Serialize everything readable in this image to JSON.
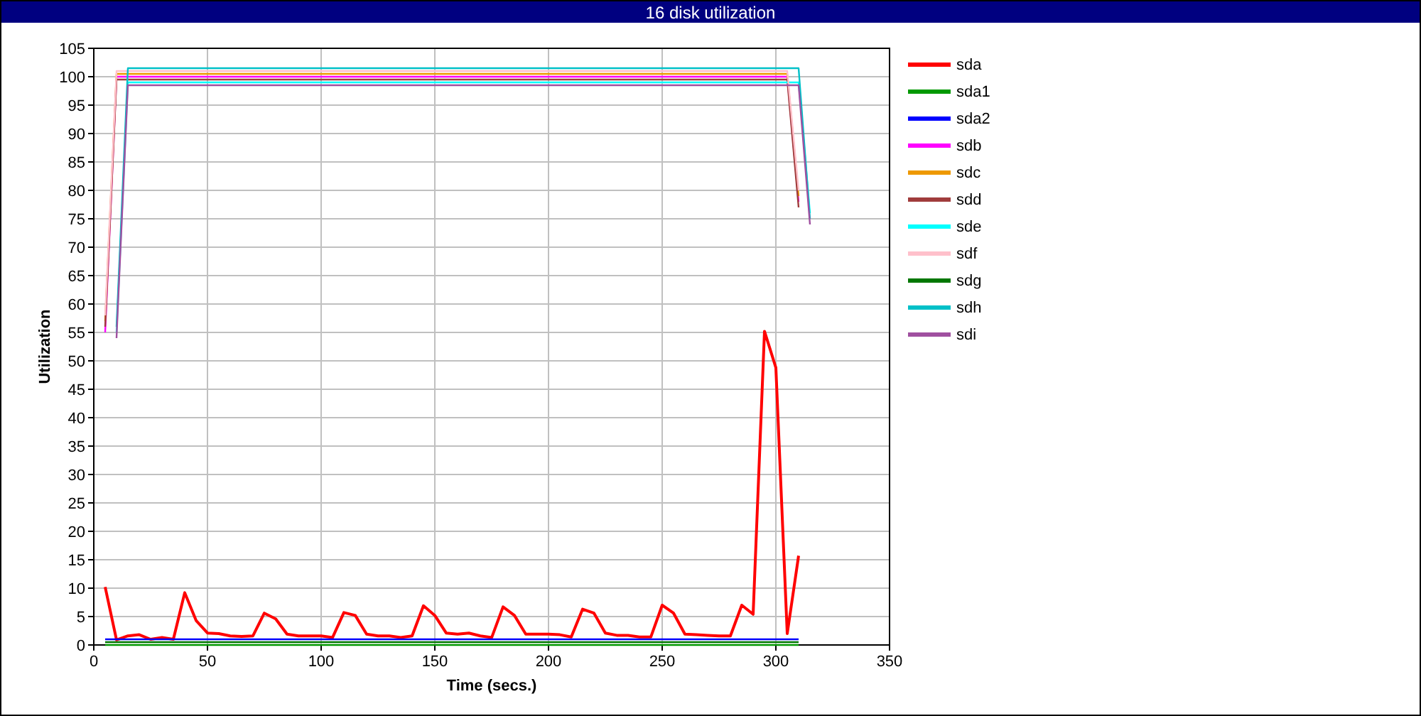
{
  "window": {
    "title": "16 disk utilization"
  },
  "chart": {
    "chart_data": {
      "type": "line",
      "grid": true,
      "xlabel": "Time (secs.)",
      "ylabel": "Utilization",
      "xlim": [
        0,
        350
      ],
      "ylim": [
        0,
        105
      ],
      "xticks": [
        0,
        50,
        100,
        150,
        200,
        250,
        300,
        350
      ],
      "yticks": [
        0,
        5,
        10,
        15,
        20,
        25,
        30,
        35,
        40,
        45,
        50,
        55,
        60,
        65,
        70,
        75,
        80,
        85,
        90,
        95,
        100,
        105
      ],
      "x": [
        5,
        10,
        15,
        20,
        25,
        30,
        35,
        40,
        45,
        50,
        55,
        60,
        65,
        70,
        75,
        80,
        85,
        90,
        95,
        100,
        105,
        110,
        115,
        120,
        125,
        130,
        135,
        140,
        145,
        150,
        155,
        160,
        165,
        170,
        175,
        180,
        185,
        190,
        195,
        200,
        205,
        210,
        215,
        220,
        225,
        230,
        235,
        240,
        245,
        250,
        255,
        260,
        265,
        270,
        275,
        280,
        285,
        290,
        295,
        300,
        305,
        310,
        315
      ],
      "series": [
        {
          "name": "sda",
          "color": "#ff0000",
          "values": [
            10.2,
            0.9,
            1.6,
            1.8,
            1.0,
            1.3,
            1.0,
            9.2,
            4.3,
            2.1,
            2.0,
            1.6,
            1.5,
            1.6,
            5.6,
            4.6,
            1.9,
            1.6,
            1.6,
            1.6,
            1.3,
            5.7,
            5.2,
            1.9,
            1.6,
            1.6,
            1.3,
            1.6,
            6.9,
            5.2,
            2.1,
            1.9,
            2.1,
            1.6,
            1.3,
            6.7,
            5.2,
            1.9,
            1.9,
            1.9,
            1.8,
            1.4,
            6.3,
            5.6,
            2.1,
            1.7,
            1.7,
            1.4,
            1.4,
            7.0,
            5.6,
            1.9,
            1.8,
            1.7,
            1.6,
            1.6,
            7.0,
            5.4,
            55.2,
            48.8,
            2.0,
            15.7,
            null
          ]
        },
        {
          "name": "sda1",
          "color": "#009900",
          "values": [
            0,
            0,
            0,
            0,
            0,
            0,
            0,
            0,
            0,
            0,
            0,
            0,
            0,
            0,
            0,
            0,
            0,
            0,
            0,
            0,
            0,
            0,
            0,
            0,
            0,
            0,
            0,
            0,
            0,
            0,
            0,
            0,
            0,
            0,
            0,
            0,
            0,
            0,
            0,
            0,
            0,
            0,
            0,
            0,
            0,
            0,
            0,
            0,
            0,
            0,
            0,
            0,
            0,
            0,
            0,
            0,
            0,
            0,
            0,
            0,
            0,
            0,
            null
          ]
        },
        {
          "name": "sda2",
          "color": "#0000ff",
          "values": [
            1,
            1,
            1,
            1,
            1,
            1,
            1,
            1,
            1,
            1,
            1,
            1,
            1,
            1,
            1,
            1,
            1,
            1,
            1,
            1,
            1,
            1,
            1,
            1,
            1,
            1,
            1,
            1,
            1,
            1,
            1,
            1,
            1,
            1,
            1,
            1,
            1,
            1,
            1,
            1,
            1,
            1,
            1,
            1,
            1,
            1,
            1,
            1,
            1,
            1,
            1,
            1,
            1,
            1,
            1,
            1,
            1,
            1,
            1,
            1,
            1,
            1,
            null
          ]
        },
        {
          "name": "sdb",
          "color": "#ff00ff",
          "values": [
            55,
            100,
            100,
            100,
            100,
            100,
            100,
            100,
            100,
            100,
            100,
            100,
            100,
            100,
            100,
            100,
            100,
            100,
            100,
            100,
            100,
            100,
            100,
            100,
            100,
            100,
            100,
            100,
            100,
            100,
            100,
            100,
            100,
            100,
            100,
            100,
            100,
            100,
            100,
            100,
            100,
            100,
            100,
            100,
            100,
            100,
            100,
            100,
            100,
            100,
            100,
            100,
            100,
            100,
            100,
            100,
            100,
            100,
            100,
            100,
            100,
            78,
            null
          ]
        },
        {
          "name": "sdc",
          "color": "#ee9900",
          "values": [
            57,
            100.5,
            100.5,
            100.5,
            100.5,
            100.5,
            100.5,
            100.5,
            100.5,
            100.5,
            100.5,
            100.5,
            100.5,
            100.5,
            100.5,
            100.5,
            100.5,
            100.5,
            100.5,
            100.5,
            100.5,
            100.5,
            100.5,
            100.5,
            100.5,
            100.5,
            100.5,
            100.5,
            100.5,
            100.5,
            100.5,
            100.5,
            100.5,
            100.5,
            100.5,
            100.5,
            100.5,
            100.5,
            100.5,
            100.5,
            100.5,
            100.5,
            100.5,
            100.5,
            100.5,
            100.5,
            100.5,
            100.5,
            100.5,
            100.5,
            100.5,
            100.5,
            100.5,
            100.5,
            100.5,
            100.5,
            100.5,
            100.5,
            100.5,
            100.5,
            100.5,
            79,
            null
          ]
        },
        {
          "name": "sdd",
          "color": "#a03c3c",
          "values": [
            56,
            99.5,
            99.5,
            99.5,
            99.5,
            99.5,
            99.5,
            99.5,
            99.5,
            99.5,
            99.5,
            99.5,
            99.5,
            99.5,
            99.5,
            99.5,
            99.5,
            99.5,
            99.5,
            99.5,
            99.5,
            99.5,
            99.5,
            99.5,
            99.5,
            99.5,
            99.5,
            99.5,
            99.5,
            99.5,
            99.5,
            99.5,
            99.5,
            99.5,
            99.5,
            99.5,
            99.5,
            99.5,
            99.5,
            99.5,
            99.5,
            99.5,
            99.5,
            99.5,
            99.5,
            99.5,
            99.5,
            99.5,
            99.5,
            99.5,
            99.5,
            99.5,
            99.5,
            99.5,
            99.5,
            99.5,
            99.5,
            99.5,
            99.5,
            99.5,
            99.5,
            77,
            null
          ]
        },
        {
          "name": "sde",
          "color": "#00ffff",
          "values": [
            null,
            55,
            99,
            99,
            99,
            99,
            99,
            99,
            99,
            99,
            99,
            99,
            99,
            99,
            99,
            99,
            99,
            99,
            99,
            99,
            99,
            99,
            99,
            99,
            99,
            99,
            99,
            99,
            99,
            99,
            99,
            99,
            99,
            99,
            99,
            99,
            99,
            99,
            99,
            99,
            99,
            99,
            99,
            99,
            99,
            99,
            99,
            99,
            99,
            99,
            99,
            99,
            99,
            99,
            99,
            99,
            99,
            99,
            99,
            99,
            99,
            99,
            76
          ]
        },
        {
          "name": "sdf",
          "color": "#ffc0cb",
          "values": [
            58,
            101,
            101,
            101,
            101,
            101,
            101,
            101,
            101,
            101,
            101,
            101,
            101,
            101,
            101,
            101,
            101,
            101,
            101,
            101,
            101,
            101,
            101,
            101,
            101,
            101,
            101,
            101,
            101,
            101,
            101,
            101,
            101,
            101,
            101,
            101,
            101,
            101,
            101,
            101,
            101,
            101,
            101,
            101,
            101,
            101,
            101,
            101,
            101,
            101,
            101,
            101,
            101,
            101,
            101,
            101,
            101,
            101,
            101,
            101,
            101,
            80,
            null
          ]
        },
        {
          "name": "sdg",
          "color": "#007700",
          "values": [
            0.5,
            0.5,
            0.5,
            0.5,
            0.5,
            0.5,
            0.5,
            0.5,
            0.5,
            0.5,
            0.5,
            0.5,
            0.5,
            0.5,
            0.5,
            0.5,
            0.5,
            0.5,
            0.5,
            0.5,
            0.5,
            0.5,
            0.5,
            0.5,
            0.5,
            0.5,
            0.5,
            0.5,
            0.5,
            0.5,
            0.5,
            0.5,
            0.5,
            0.5,
            0.5,
            0.5,
            0.5,
            0.5,
            0.5,
            0.5,
            0.5,
            0.5,
            0.5,
            0.5,
            0.5,
            0.5,
            0.5,
            0.5,
            0.5,
            0.5,
            0.5,
            0.5,
            0.5,
            0.5,
            0.5,
            0.5,
            0.5,
            0.5,
            0.5,
            0.5,
            0.5,
            0.5,
            null
          ]
        },
        {
          "name": "sdh",
          "color": "#00c0c8",
          "values": [
            null,
            56,
            101.5,
            101.5,
            101.5,
            101.5,
            101.5,
            101.5,
            101.5,
            101.5,
            101.5,
            101.5,
            101.5,
            101.5,
            101.5,
            101.5,
            101.5,
            101.5,
            101.5,
            101.5,
            101.5,
            101.5,
            101.5,
            101.5,
            101.5,
            101.5,
            101.5,
            101.5,
            101.5,
            101.5,
            101.5,
            101.5,
            101.5,
            101.5,
            101.5,
            101.5,
            101.5,
            101.5,
            101.5,
            101.5,
            101.5,
            101.5,
            101.5,
            101.5,
            101.5,
            101.5,
            101.5,
            101.5,
            101.5,
            101.5,
            101.5,
            101.5,
            101.5,
            101.5,
            101.5,
            101.5,
            101.5,
            101.5,
            101.5,
            101.5,
            101.5,
            101.5,
            75
          ]
        },
        {
          "name": "sdi",
          "color": "#a050a0",
          "values": [
            null,
            54,
            98.5,
            98.5,
            98.5,
            98.5,
            98.5,
            98.5,
            98.5,
            98.5,
            98.5,
            98.5,
            98.5,
            98.5,
            98.5,
            98.5,
            98.5,
            98.5,
            98.5,
            98.5,
            98.5,
            98.5,
            98.5,
            98.5,
            98.5,
            98.5,
            98.5,
            98.5,
            98.5,
            98.5,
            98.5,
            98.5,
            98.5,
            98.5,
            98.5,
            98.5,
            98.5,
            98.5,
            98.5,
            98.5,
            98.5,
            98.5,
            98.5,
            98.5,
            98.5,
            98.5,
            98.5,
            98.5,
            98.5,
            98.5,
            98.5,
            98.5,
            98.5,
            98.5,
            98.5,
            98.5,
            98.5,
            98.5,
            98.5,
            98.5,
            98.5,
            98.5,
            74
          ]
        }
      ]
    }
  }
}
